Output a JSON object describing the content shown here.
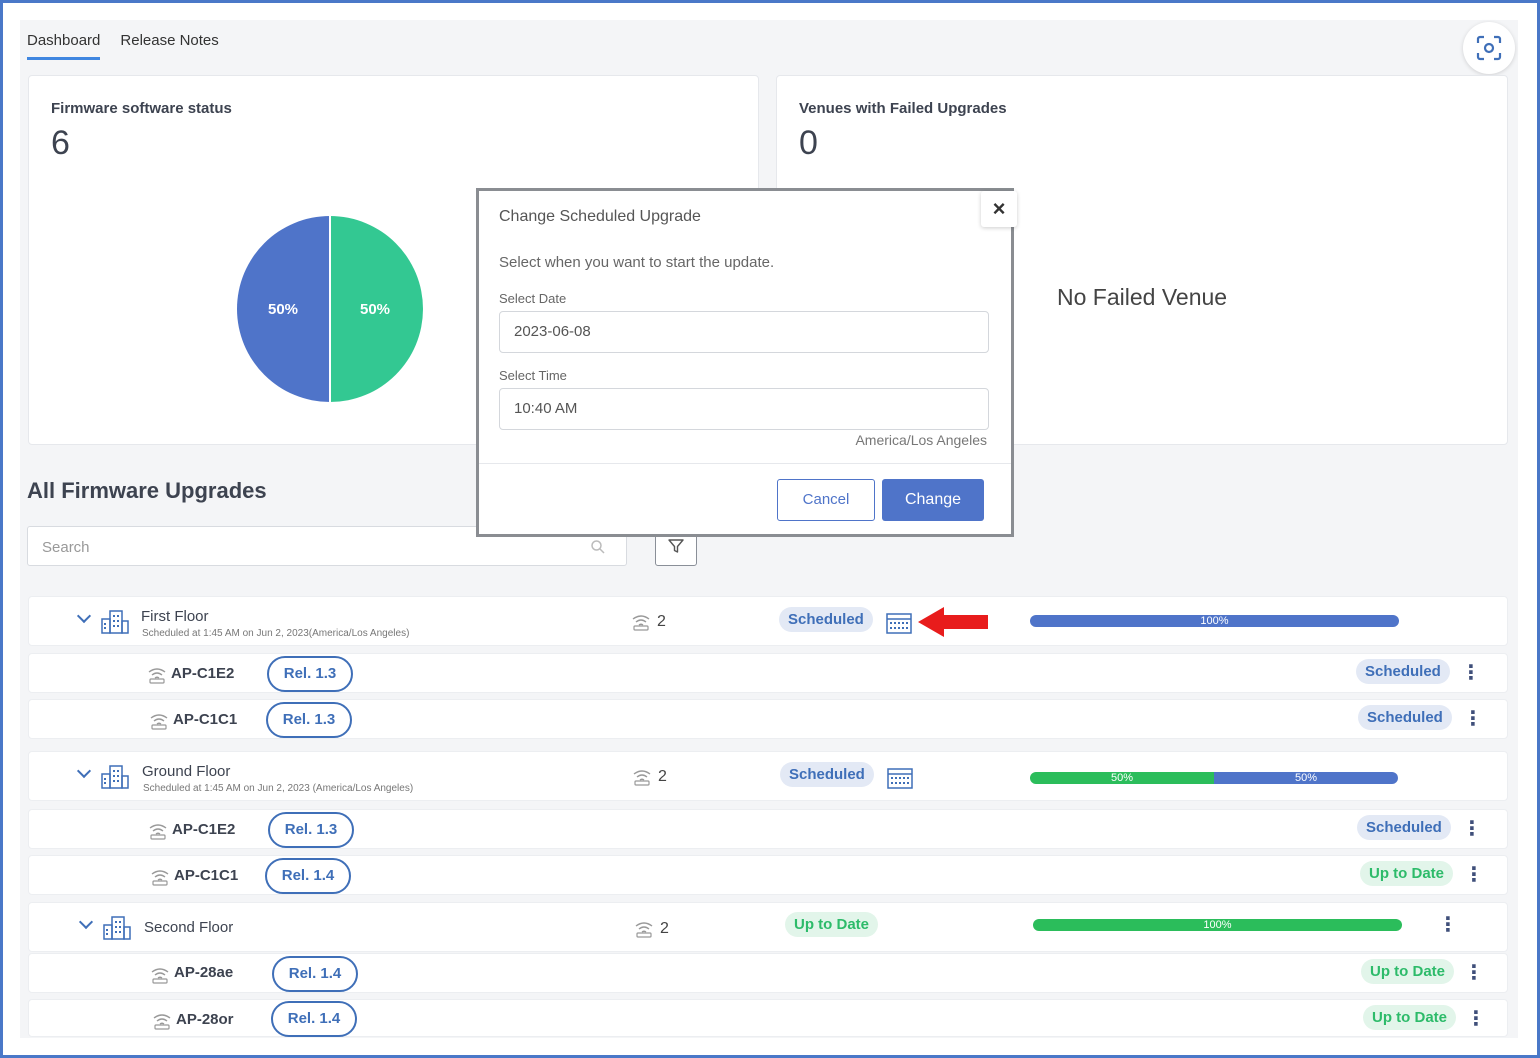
{
  "tabs": [
    {
      "label": "Dashboard",
      "active": true
    },
    {
      "label": "Release Notes",
      "active": false
    }
  ],
  "firmware_card": {
    "title": "Firmware software status",
    "count": "6",
    "pie": [
      {
        "label": "50%",
        "value": 50,
        "color": "#4f74c9"
      },
      {
        "label": "50%",
        "value": 50,
        "color": "#33c892"
      }
    ]
  },
  "failed_card": {
    "title": "Venues with Failed Upgrades",
    "count": "0",
    "empty_text": "No Failed Venue"
  },
  "section": {
    "title": "All Firmware Upgrades",
    "search_placeholder": "Search"
  },
  "venues": [
    {
      "name": "First Floor",
      "subtitle": "Scheduled at 1:45 AM on Jun 2, 2023(America/Los Angeles)",
      "ap_count": "2",
      "status": "Scheduled",
      "progress": [
        {
          "label": "100%",
          "value": 100,
          "color": "blue"
        }
      ],
      "aps": [
        {
          "name": "AP-C1E2",
          "release": "Rel. 1.3",
          "status": "Scheduled"
        },
        {
          "name": "AP-C1C1",
          "release": "Rel. 1.3",
          "status": "Scheduled"
        }
      ]
    },
    {
      "name": "Ground Floor",
      "subtitle": "Scheduled at 1:45 AM on Jun 2, 2023 (America/Los Angeles)",
      "ap_count": "2",
      "status": "Scheduled",
      "progress": [
        {
          "label": "50%",
          "value": 50,
          "color": "green"
        },
        {
          "label": "50%",
          "value": 50,
          "color": "blue"
        }
      ],
      "aps": [
        {
          "name": "AP-C1E2",
          "release": "Rel. 1.3",
          "status": "Scheduled"
        },
        {
          "name": "AP-C1C1",
          "release": "Rel. 1.4",
          "status": "Up to Date"
        }
      ]
    },
    {
      "name": "Second Floor",
      "subtitle": "",
      "ap_count": "2",
      "status": "Up to Date",
      "progress": [
        {
          "label": "100%",
          "value": 100,
          "color": "green"
        }
      ],
      "aps": [
        {
          "name": "AP-28ae",
          "release": "Rel. 1.4",
          "status": "Up to Date"
        },
        {
          "name": "AP-28or",
          "release": "Rel. 1.4",
          "status": "Up to Date"
        }
      ]
    }
  ],
  "modal": {
    "title": "Change Scheduled Upgrade",
    "close": "×",
    "description": "Select when you want to start the update.",
    "date_label": "Select Date",
    "date_value": "2023-06-08",
    "time_label": "Select Time",
    "time_value": "10:40 AM",
    "timezone": "America/Los Angeles",
    "cancel_label": "Cancel",
    "change_label": "Change"
  }
}
